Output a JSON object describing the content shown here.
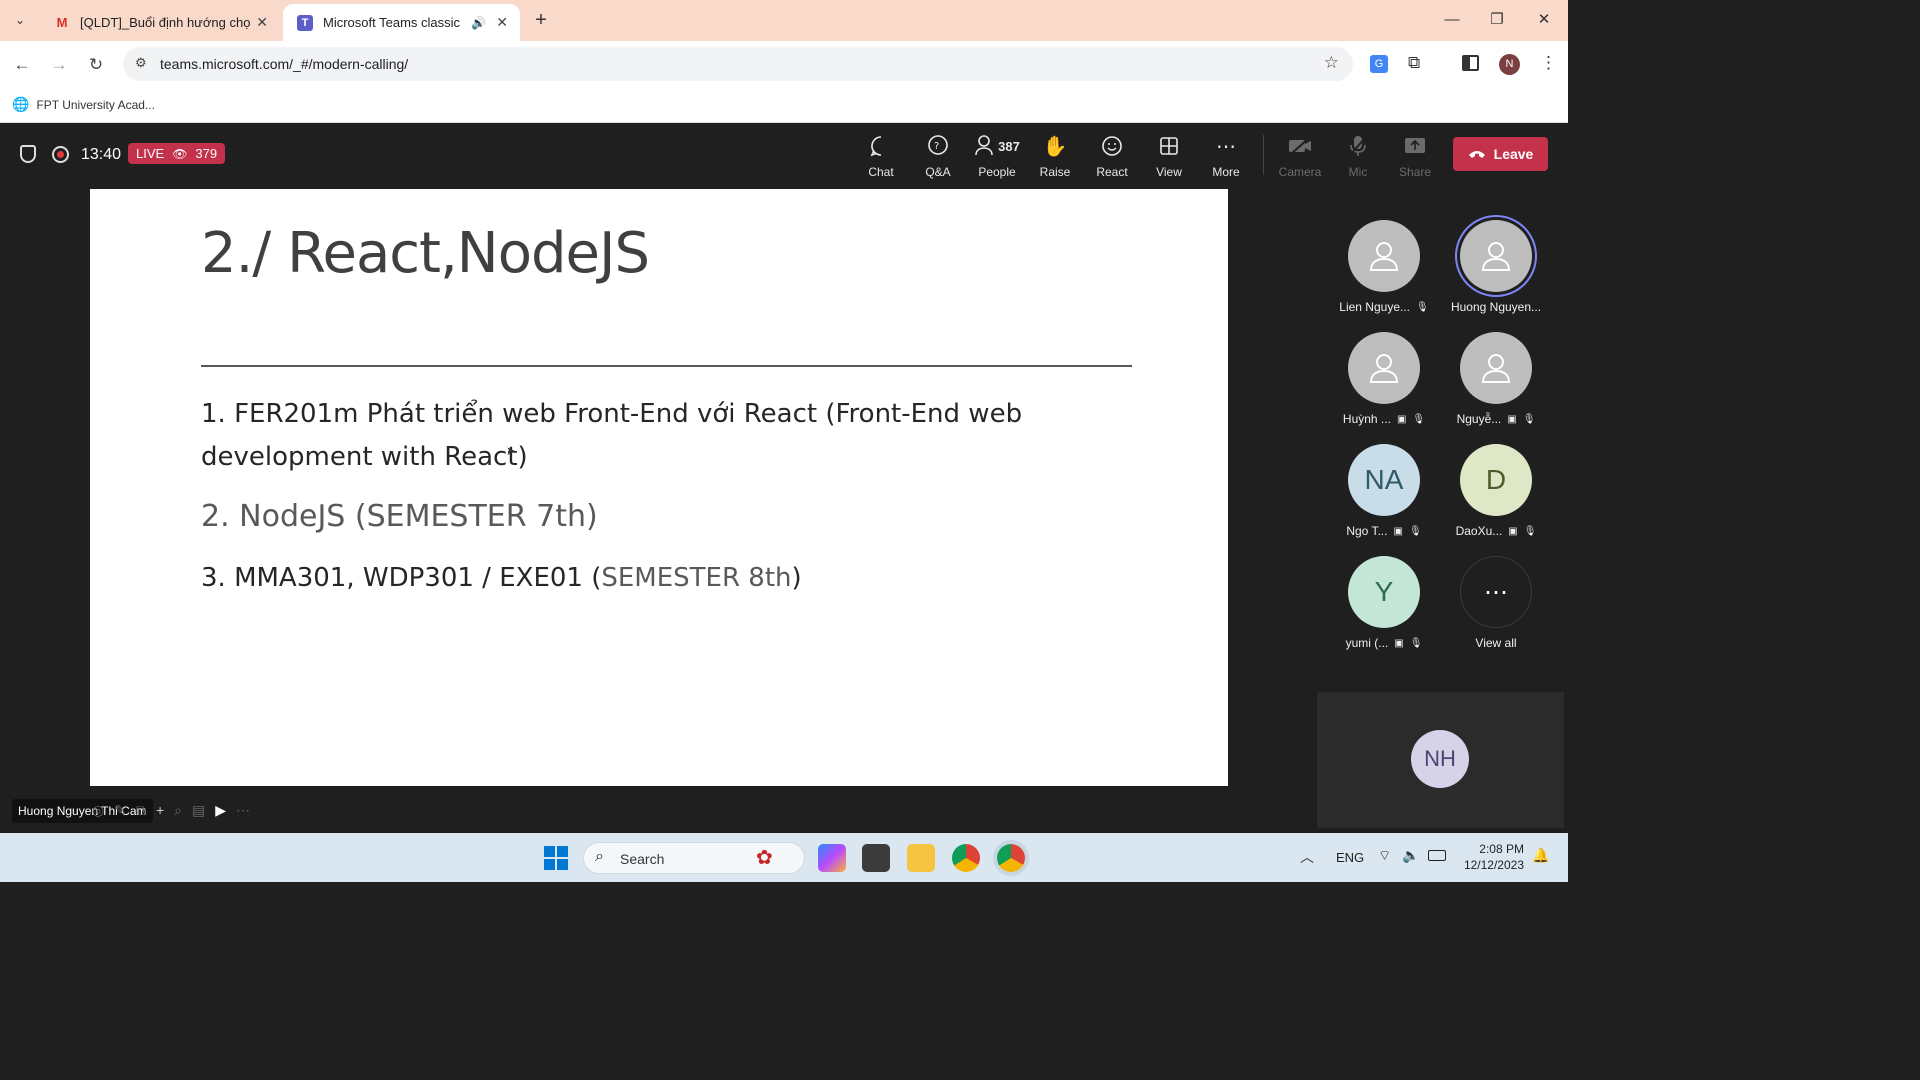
{
  "browser": {
    "tabs": [
      {
        "title": "[QLDT]_Buổi định hướng chọn (",
        "favicon": "gmail-icon"
      },
      {
        "title": "Microsoft Teams classic",
        "favicon": "teams-icon"
      }
    ],
    "url": "teams.microsoft.com/_#/modern-calling/",
    "bookmark": "FPT University Acad...",
    "profile_initial": "N"
  },
  "meeting": {
    "timer": "13:40",
    "live_label": "LIVE",
    "viewers": "379",
    "controls": {
      "chat": "Chat",
      "qa": "Q&A",
      "people": "People",
      "people_count": "387",
      "raise": "Raise",
      "react": "React",
      "view": "View",
      "more": "More",
      "camera": "Camera",
      "mic": "Mic",
      "share": "Share",
      "leave": "Leave"
    },
    "presenter_label": "Huong Nguyen Thi Cam"
  },
  "slide": {
    "title": "2./ React,NodeJS",
    "bullet1_lead": "1. FER201m Phát triển web Front-End với React (Front-End web development with React)",
    "bullet2": "2. NodeJS (SEMESTER 7th)",
    "bullet3_main": "3. MMA301, WDP301 / EXE01 (",
    "bullet3_grey": "SEMESTER 8th",
    "bullet3_end": ")"
  },
  "participants": [
    {
      "name": "Lien Nguye...",
      "avatar": "person-icon",
      "initials": "",
      "color": "#bdbdbd"
    },
    {
      "name": "Huong Nguyen...",
      "avatar": "person-icon",
      "initials": "",
      "color": "#bdbdbd"
    },
    {
      "name": "Huỳnh ...",
      "avatar": "person-icon",
      "initials": "",
      "color": "#bdbdbd"
    },
    {
      "name": "Nguyễ...",
      "avatar": "person-icon",
      "initials": "",
      "color": "#bdbdbd"
    },
    {
      "name": "Ngo T...",
      "avatar": "initials",
      "initials": "NA",
      "color": "#c8dde7"
    },
    {
      "name": "DaoXu...",
      "avatar": "initials",
      "initials": "D",
      "color": "#dfe8c6"
    },
    {
      "name": "yumi (...",
      "avatar": "initials",
      "initials": "Y",
      "color": "#c3e6d6"
    },
    {
      "name": "View all",
      "avatar": "more-icon",
      "initials": "",
      "color": "#2b2b2b"
    }
  ],
  "self_view": {
    "initials": "NH"
  },
  "taskbar": {
    "search": "Search",
    "lang": "ENG",
    "time": "2:08 PM",
    "date": "12/12/2023"
  }
}
